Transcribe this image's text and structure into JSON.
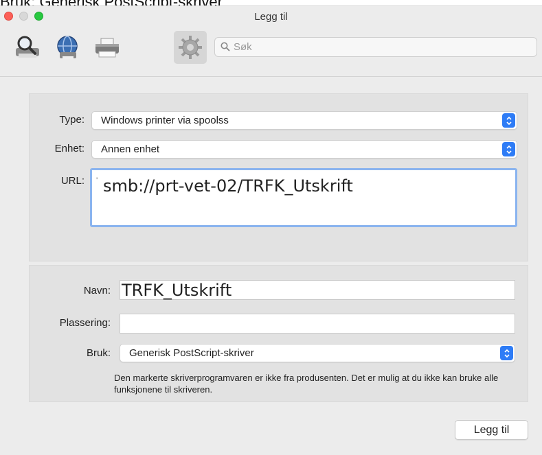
{
  "caption": "Bruk: Generisk PostScript-skriver",
  "window": {
    "title": "Legg til"
  },
  "toolbar": {
    "buttons": [
      {
        "name": "default-printers",
        "icon": "magnifier-printer-icon"
      },
      {
        "name": "ip-printer",
        "icon": "globe-icon"
      },
      {
        "name": "windows-printer",
        "icon": "printer-icon"
      },
      {
        "name": "advanced",
        "icon": "gear-icon",
        "selected": true
      }
    ],
    "search_placeholder": "Søk"
  },
  "form": {
    "type_label": "Type:",
    "type_value": "Windows printer via spoolss",
    "device_label": "Enhet:",
    "device_value": "Annen enhet",
    "url_label": "URL:",
    "url_value": "smb://prt-vet-02/TRFK_Utskrift",
    "url_marker": "'",
    "name_label": "Navn:",
    "name_value": "TRFK_Utskrift",
    "location_label": "Plassering:",
    "location_value": "",
    "use_label": "Bruk:",
    "use_value": "Generisk PostScript-skriver",
    "warning": "Den markerte skriverprogramvaren er ikke fra produsenten. Det er mulig at du ikke kan bruke alle funksjonene til skriveren."
  },
  "actions": {
    "add_label": "Legg til"
  },
  "colors": {
    "accent": "#2e7cf6",
    "focus_ring": "#8ab4ef",
    "close": "#fc5f57",
    "zoom": "#28c840"
  }
}
